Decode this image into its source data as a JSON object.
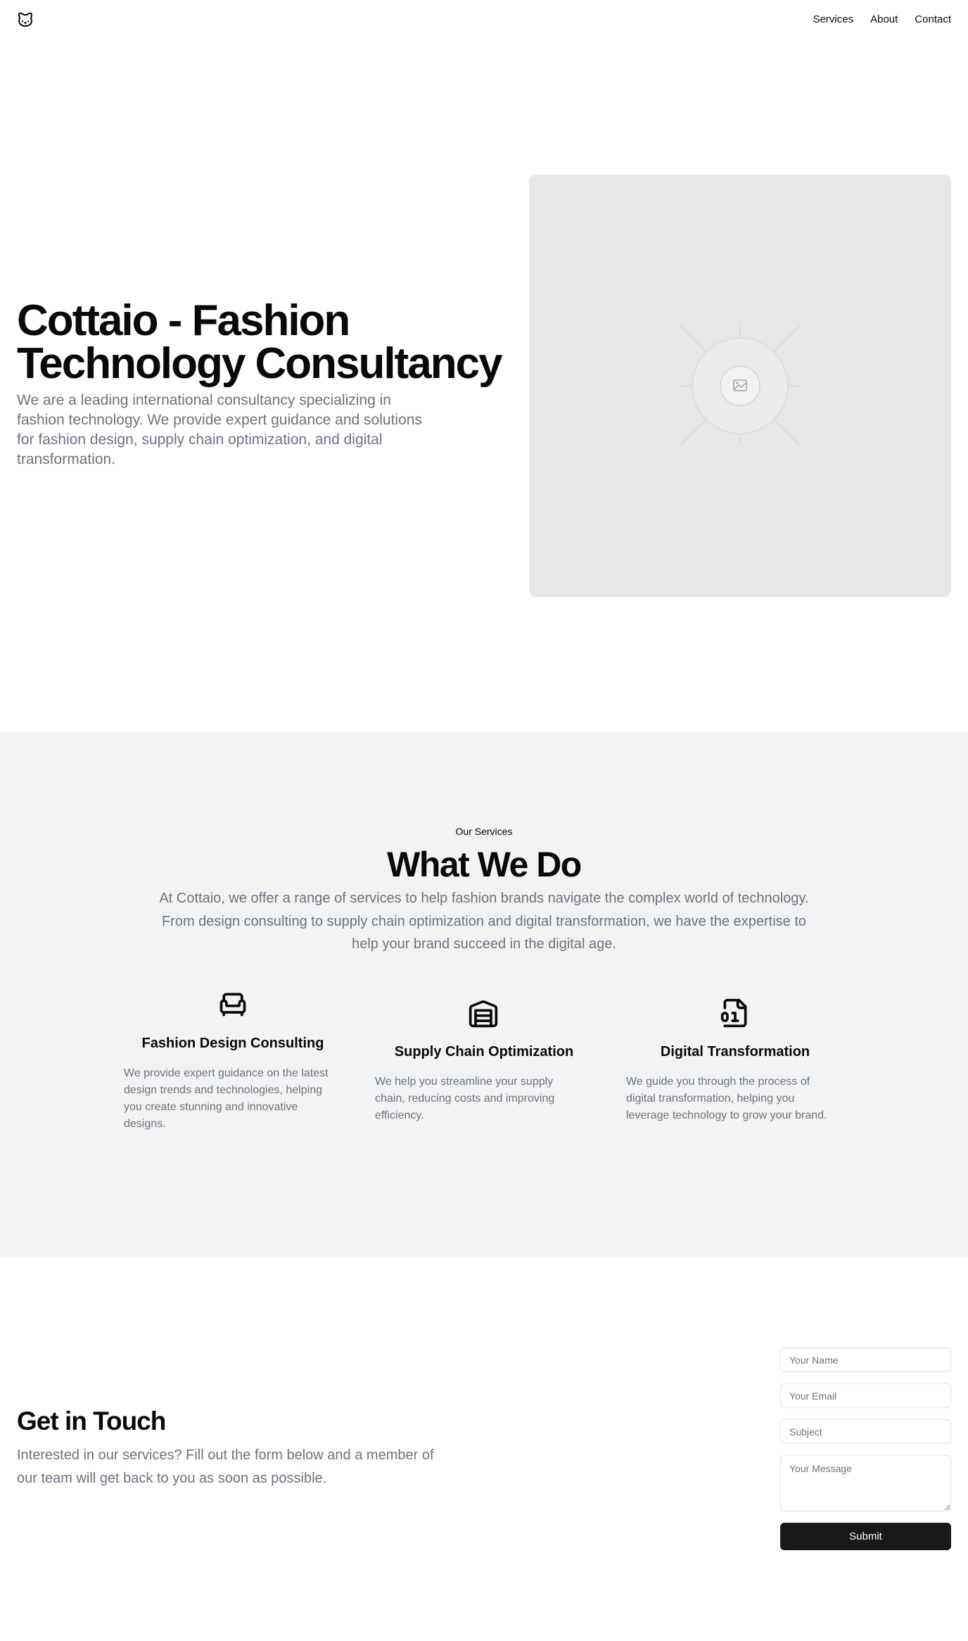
{
  "header": {
    "logo_icon": "cat-logo-icon",
    "nav": [
      {
        "label": "Services"
      },
      {
        "label": "About"
      },
      {
        "label": "Contact"
      }
    ]
  },
  "hero": {
    "title_line1": "Cottaio - Fashion",
    "title_line2": "Technology Consultancy",
    "subtitle": "We are a leading international consultancy specializing in fashion technology. We provide expert guidance and solutions for fashion design, supply chain optimization, and digital transformation.",
    "image_icon": "image-placeholder-icon"
  },
  "services": {
    "eyebrow": "Our Services",
    "title": "What We Do",
    "description": "At Cottaio, we offer a range of services to help fashion brands navigate the complex world of technology. From design consulting to supply chain optimization and digital transformation, we have the expertise to help your brand succeed in the digital age.",
    "cards": [
      {
        "icon": "armchair-icon",
        "title": "Fashion Design Consulting",
        "text": "We provide expert guidance on the latest design trends and technologies, helping you create stunning and innovative designs."
      },
      {
        "icon": "warehouse-icon",
        "title": "Supply Chain Optimization",
        "text": "We help you streamline your supply chain, reducing costs and improving efficiency."
      },
      {
        "icon": "binary-file-icon",
        "title": "Digital Transformation",
        "text": "We guide you through the process of digital transformation, helping you leverage technology to grow your brand."
      }
    ]
  },
  "contact": {
    "title": "Get in Touch",
    "subtitle": "Interested in our services? Fill out the form below and a member of our team will get back to you as soon as possible.",
    "form": {
      "name_placeholder": "Your Name",
      "email_placeholder": "Your Email",
      "subject_placeholder": "Subject",
      "message_placeholder": "Your Message",
      "submit_label": "Submit"
    }
  }
}
